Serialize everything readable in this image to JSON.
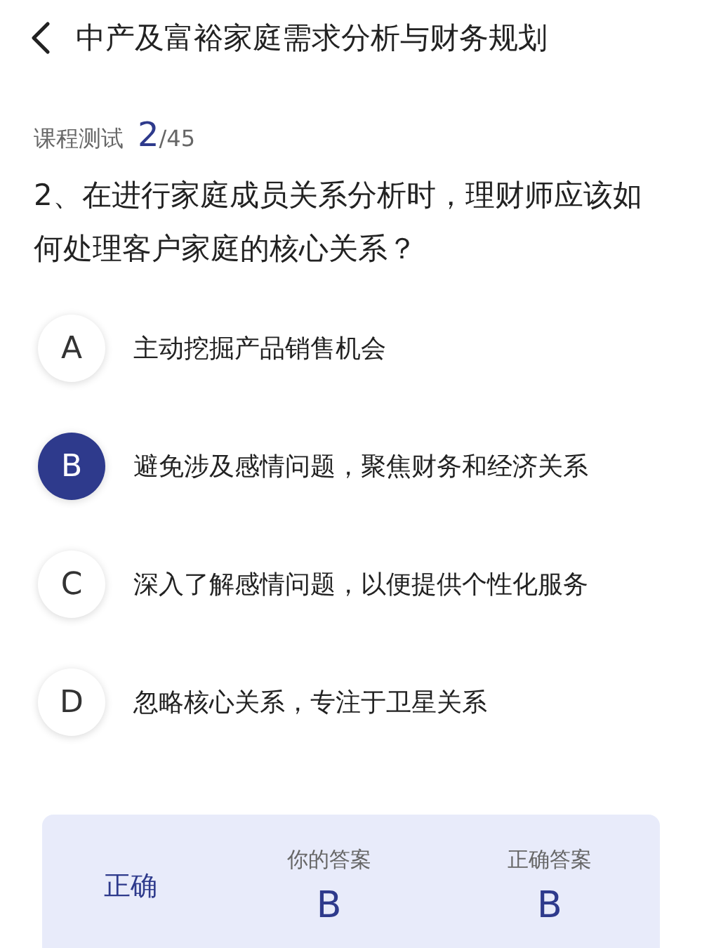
{
  "header": {
    "title": "中产及富裕家庭需求分析与财务规划"
  },
  "progress": {
    "label": "课程测试",
    "current": "2",
    "total": "/45"
  },
  "question": "2、在进行家庭成员关系分析时，理财师应该如何处理客户家庭的核心关系？",
  "options": [
    {
      "letter": "A",
      "text": "主动挖掘产品销售机会",
      "selected": false
    },
    {
      "letter": "B",
      "text": "避免涉及感情问题，聚焦财务和经济关系",
      "selected": true
    },
    {
      "letter": "C",
      "text": "深入了解感情问题，以便提供个性化服务",
      "selected": false
    },
    {
      "letter": "D",
      "text": "忽略核心关系，专注于卫星关系",
      "selected": false
    }
  ],
  "result": {
    "status": "正确",
    "your_answer_label": "你的答案",
    "your_answer": "B",
    "correct_answer_label": "正确答案",
    "correct_answer": "B"
  }
}
